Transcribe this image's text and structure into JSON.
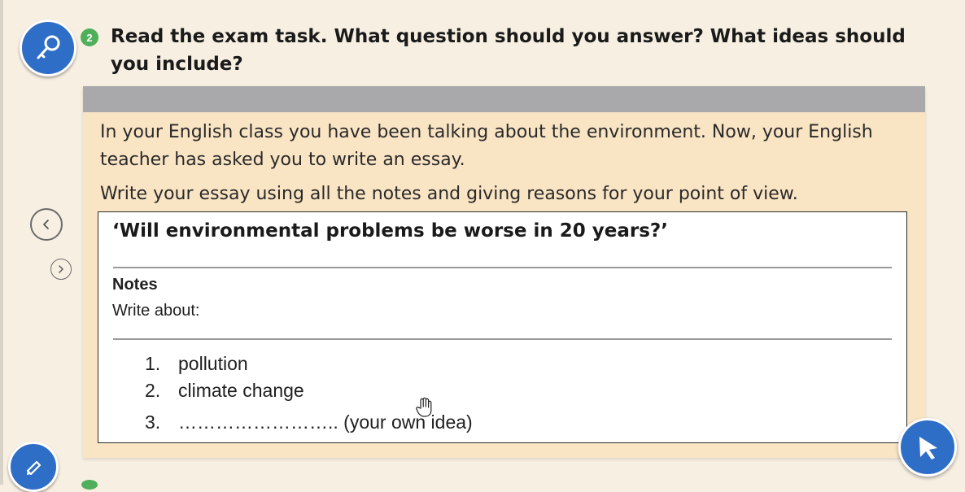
{
  "exercise": {
    "step_number": "2",
    "question": "Read the exam task. What question should you answer? What ideas should you include?"
  },
  "task": {
    "intro": "In your English class you have been talking about the environment. Now, your English teacher has asked you to write an essay.",
    "instruction": "Write your essay using all the notes and giving reasons for your point of view.",
    "essay_title": "‘Will environmental problems be worse in 20 years?’",
    "notes_heading": "Notes",
    "notes_sub": "Write about:",
    "notes": [
      {
        "num": "1.",
        "text": "pollution"
      },
      {
        "num": "2.",
        "text": "climate change"
      },
      {
        "num": "3.",
        "text": "…………………….. (your own idea)"
      }
    ]
  },
  "controls": {
    "key_icon": "key-icon",
    "prev_icon": "chevron-left-icon",
    "next_icon": "chevron-right-icon",
    "edit_icon": "pencil-icon",
    "pointer_icon": "arrow-cursor-icon"
  },
  "colors": {
    "page_bg": "#f7efe1",
    "card_bg": "#f9e4c4",
    "header_bar": "#a9a9ab",
    "accent_blue": "#2f6ec7",
    "step_green": "#4faf5a"
  }
}
